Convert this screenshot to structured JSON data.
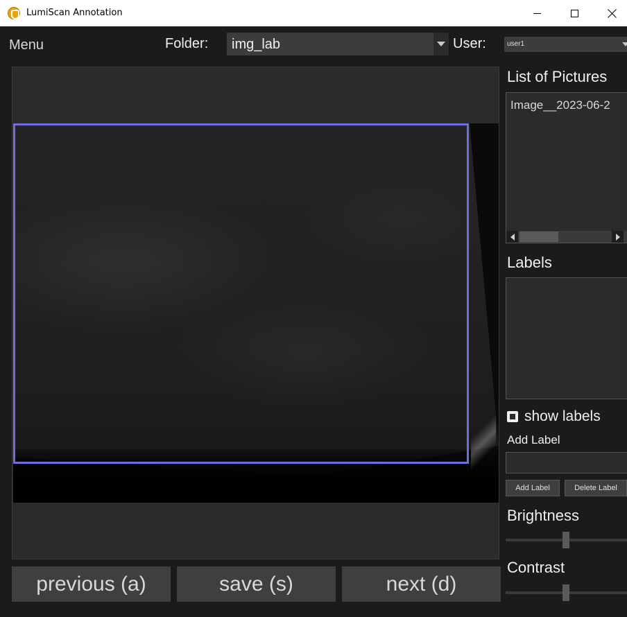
{
  "window": {
    "title": "LumiScan Annotation",
    "controls": [
      "minimize",
      "maximize",
      "close"
    ]
  },
  "topbar": {
    "menu_label": "Menu",
    "folder_label": "Folder:",
    "folder_value": "img_lab",
    "user_label": "User:",
    "user_value": "user1"
  },
  "viewer": {
    "bounding_box_color": "#6e6edc"
  },
  "nav": {
    "previous_label": "previous (a)",
    "save_label": "save (s)",
    "next_label": "next (d)"
  },
  "sidebar": {
    "pictures_heading": "List of Pictures",
    "pictures": [
      "Image__2023-06-2"
    ],
    "labels_heading": "Labels",
    "labels": [],
    "show_labels_text": "show labels",
    "show_labels_checked": true,
    "add_label_caption": "Add Label",
    "add_label_input_value": "",
    "add_label_button": "Add Label",
    "delete_label_button": "Delete Label",
    "brightness_heading": "Brightness",
    "brightness_level": 0.5,
    "contrast_heading": "Contrast",
    "contrast_level": 0.5
  },
  "icons": {
    "app": "lumiscan-logo-icon",
    "combo_arrow": "chevron-down-icon",
    "scroll_left": "arrow-left-icon",
    "scroll_right": "arrow-right-icon"
  }
}
